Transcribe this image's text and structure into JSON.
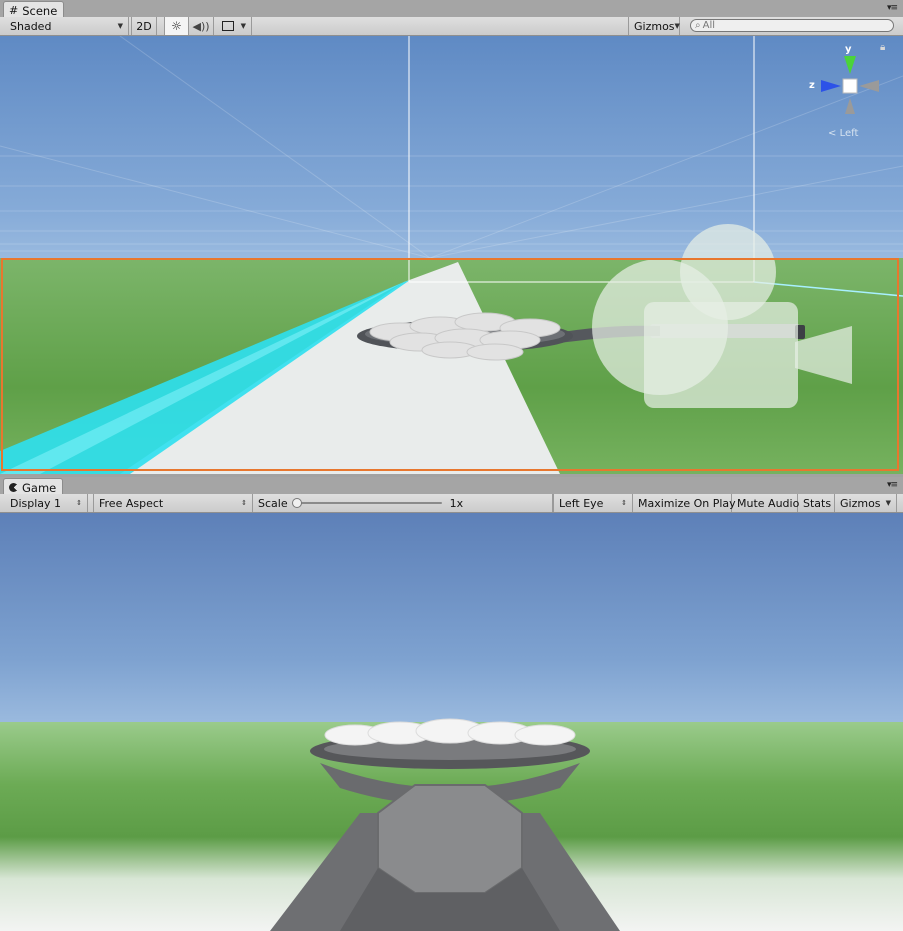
{
  "scene_tab": {
    "label": "Scene",
    "icon": "grid-icon"
  },
  "scene_toolbar": {
    "draw_mode": "Shaded",
    "mode_2d": "2D",
    "gizmos": "Gizmos",
    "search_placeholder": "All"
  },
  "orientation_gizmo": {
    "y_label": "y",
    "z_label": "z",
    "view_label": "Left"
  },
  "game_tab": {
    "label": "Game",
    "icon": "pacman-icon"
  },
  "game_toolbar": {
    "display": "Display 1",
    "aspect": "Free Aspect",
    "scale_label": "Scale",
    "scale_value": "1x",
    "eye": "Left Eye",
    "maximize": "Maximize On Play",
    "mute": "Mute Audio",
    "stats": "Stats",
    "gizmos": "Gizmos"
  },
  "colors": {
    "selection_outline": "#e8772e",
    "accent_cyan": "#00e5ff",
    "sky_top": "#5f8ac4"
  }
}
